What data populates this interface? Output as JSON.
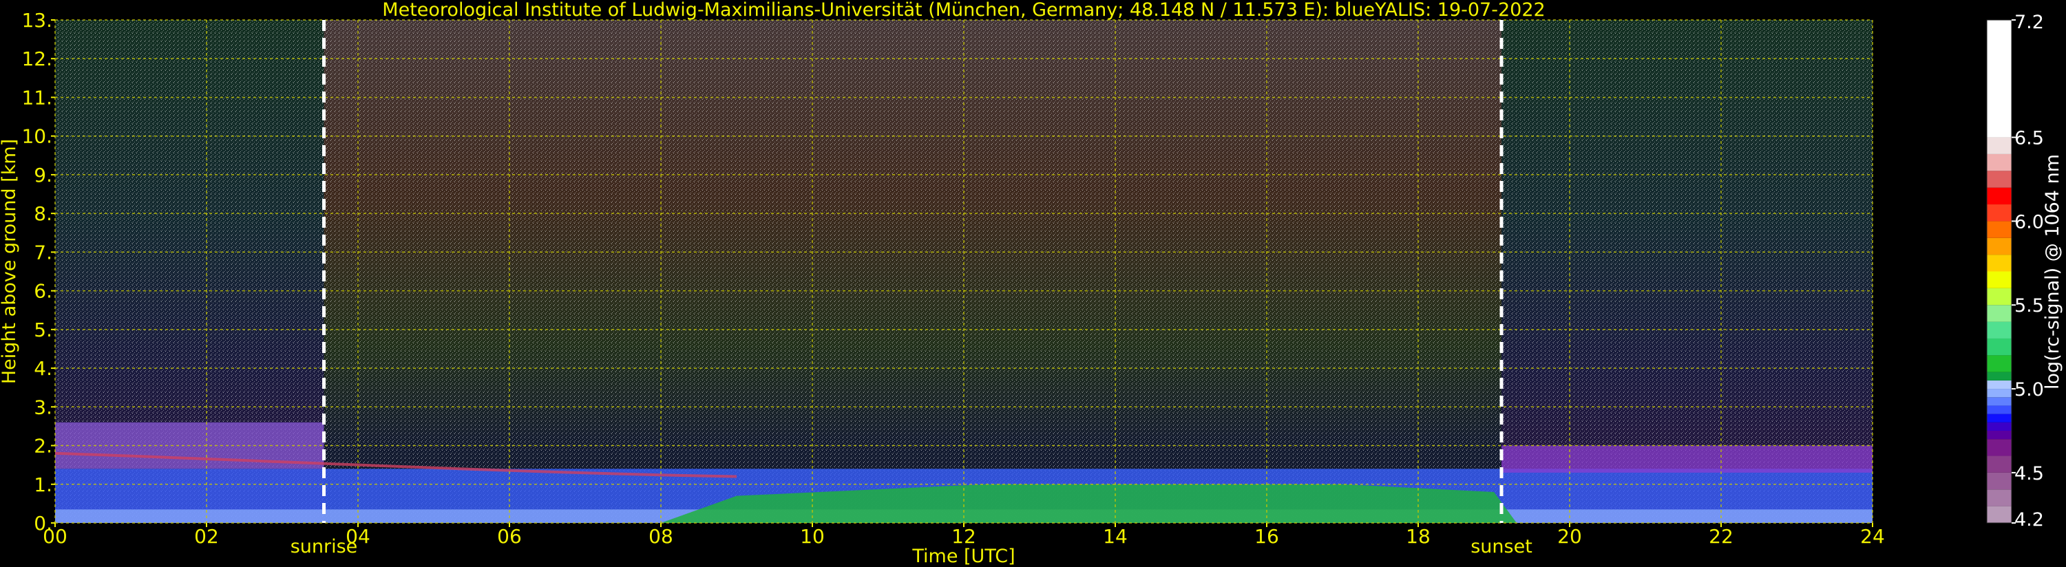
{
  "chart_data": {
    "type": "heatmap",
    "title": "Meteorological Institute of Ludwig-Maximilians-Universität (München, Germany; 48.148 N / 11.573 E):    blueYALIS: 19-07-2022",
    "xlabel": "Time [UTC]",
    "ylabel": "Height above ground [km]",
    "xlim": [
      0,
      24
    ],
    "ylim": [
      0,
      13
    ],
    "x_ticks": [
      "00",
      "02",
      "04",
      "06",
      "08",
      "10",
      "12",
      "14",
      "16",
      "18",
      "20",
      "22",
      "24"
    ],
    "x_tick_values": [
      0,
      2,
      4,
      6,
      8,
      10,
      12,
      14,
      16,
      18,
      20,
      22,
      24
    ],
    "y_ticks": [
      "0.",
      "1.",
      "2.",
      "3.",
      "4.",
      "5.",
      "6.",
      "7.",
      "8.",
      "9.",
      "10.",
      "11.",
      "12.",
      "13."
    ],
    "y_tick_values": [
      0,
      1,
      2,
      3,
      4,
      5,
      6,
      7,
      8,
      9,
      10,
      11,
      12,
      13
    ],
    "grid": true,
    "markers": [
      {
        "label": "sunrise",
        "time": 3.55
      },
      {
        "label": "sunset",
        "time": 19.1
      }
    ],
    "colorbar": {
      "label": "log(rc-signal) @ 1064 nm",
      "min": 4.2,
      "max": 7.2,
      "tick_labels": [
        "4.2",
        "4.5",
        "5.0",
        "5.5",
        "6.0",
        "6.5",
        "7.2"
      ],
      "tick_values": [
        4.2,
        4.5,
        5.0,
        5.5,
        6.0,
        6.5,
        7.2
      ],
      "segments": [
        {
          "from": 4.2,
          "to": 4.3,
          "color": "#b89ab8"
        },
        {
          "from": 4.3,
          "to": 4.4,
          "color": "#a87ba8"
        },
        {
          "from": 4.4,
          "to": 4.5,
          "color": "#985c98"
        },
        {
          "from": 4.5,
          "to": 4.6,
          "color": "#8a3d8a"
        },
        {
          "from": 4.6,
          "to": 4.7,
          "color": "#7a1a8a"
        },
        {
          "from": 4.7,
          "to": 4.75,
          "color": "#5a00a0"
        },
        {
          "from": 4.75,
          "to": 4.8,
          "color": "#3a00c8"
        },
        {
          "from": 4.8,
          "to": 4.85,
          "color": "#1010ff"
        },
        {
          "from": 4.85,
          "to": 4.9,
          "color": "#3a50ff"
        },
        {
          "from": 4.9,
          "to": 4.95,
          "color": "#6080ff"
        },
        {
          "from": 4.95,
          "to": 5.0,
          "color": "#90b0ff"
        },
        {
          "from": 5.0,
          "to": 5.05,
          "color": "#b0c8ff"
        },
        {
          "from": 5.05,
          "to": 5.1,
          "color": "#10a040"
        },
        {
          "from": 5.1,
          "to": 5.2,
          "color": "#20c030"
        },
        {
          "from": 5.2,
          "to": 5.3,
          "color": "#30d070"
        },
        {
          "from": 5.3,
          "to": 5.4,
          "color": "#50e090"
        },
        {
          "from": 5.4,
          "to": 5.5,
          "color": "#90f090"
        },
        {
          "from": 5.5,
          "to": 5.6,
          "color": "#c0ff40"
        },
        {
          "from": 5.6,
          "to": 5.7,
          "color": "#f0ff00"
        },
        {
          "from": 5.7,
          "to": 5.8,
          "color": "#ffd000"
        },
        {
          "from": 5.8,
          "to": 5.9,
          "color": "#ffa000"
        },
        {
          "from": 5.9,
          "to": 6.0,
          "color": "#ff7000"
        },
        {
          "from": 6.0,
          "to": 6.1,
          "color": "#ff4020"
        },
        {
          "from": 6.1,
          "to": 6.2,
          "color": "#ff0000"
        },
        {
          "from": 6.2,
          "to": 6.3,
          "color": "#e06060"
        },
        {
          "from": 6.3,
          "to": 6.4,
          "color": "#f0b0b0"
        },
        {
          "from": 6.4,
          "to": 6.5,
          "color": "#f0e0e0"
        },
        {
          "from": 6.5,
          "to": 7.2,
          "color": "#ffffff"
        }
      ]
    }
  },
  "colors": {
    "label_yellow": "#f2f200",
    "grid_yellow": "#c8c800",
    "background": "#000000"
  }
}
